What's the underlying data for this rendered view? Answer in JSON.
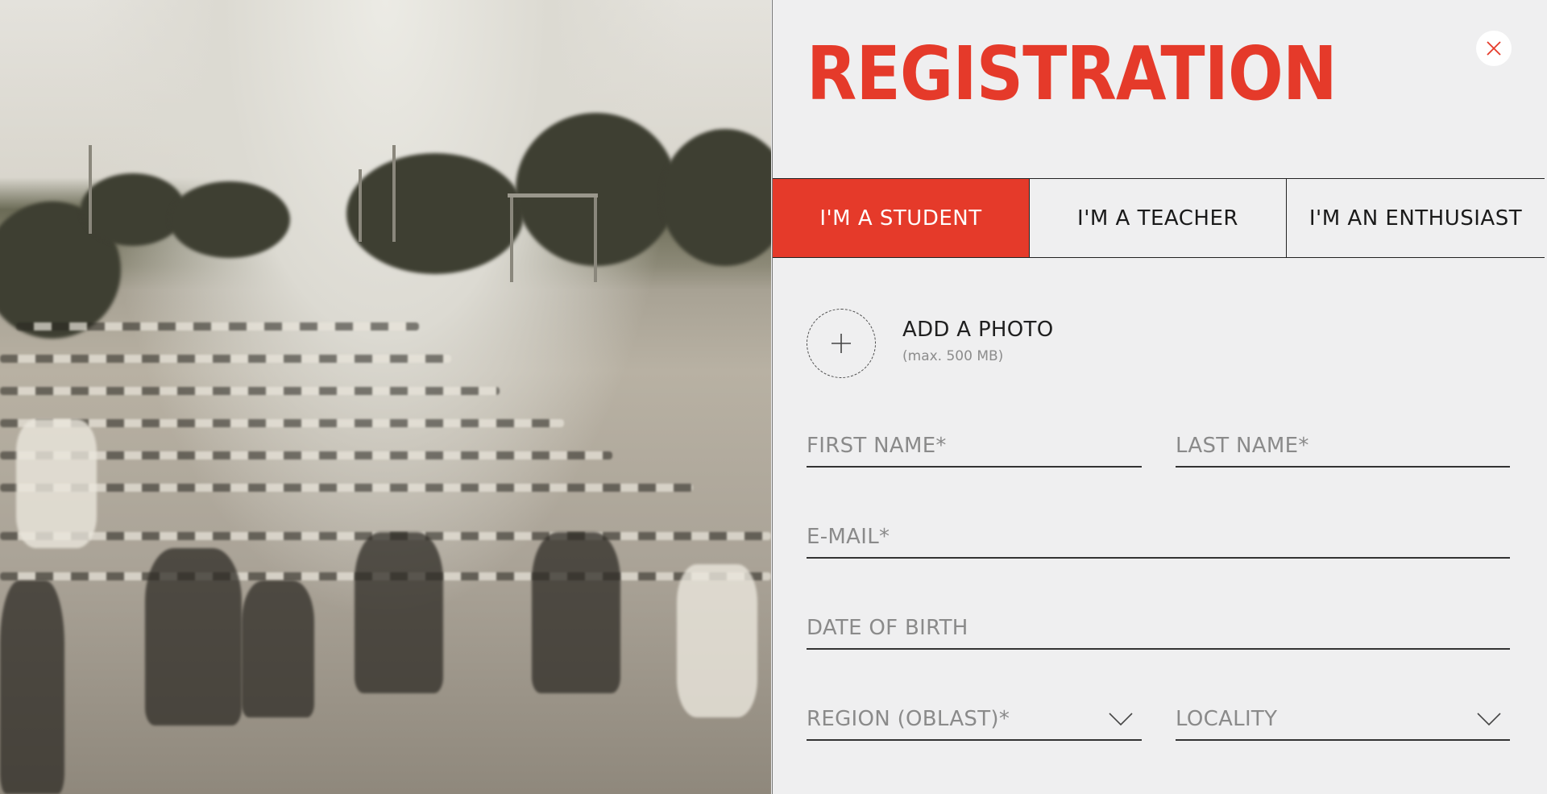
{
  "form": {
    "title": "REGISTRATION",
    "close_icon": "close-icon",
    "tabs": [
      {
        "label": "I'M A STUDENT",
        "active": true
      },
      {
        "label": "I'M A TEACHER",
        "active": false
      },
      {
        "label": "I'M AN ENTHUSIAST",
        "active": false
      }
    ],
    "photo": {
      "label": "ADD A PHOTO",
      "hint": "(max. 500 MB)",
      "icon": "plus-icon"
    },
    "fields": {
      "first_name": "FIRST NAME*",
      "last_name": "LAST NAME*",
      "email": "E-MAIL*",
      "date_of_birth": "DATE OF BIRTH",
      "region": "REGION (OBLAST)*",
      "locality": "LOCALITY"
    }
  },
  "colors": {
    "accent": "#e53a2a",
    "panel_bg": "#efeff0",
    "placeholder": "#8a8a8a",
    "underline": "#333333"
  }
}
